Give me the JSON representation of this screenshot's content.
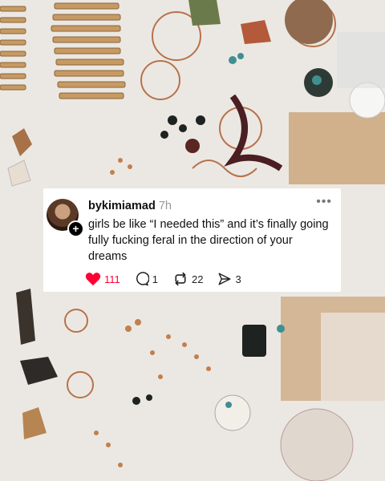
{
  "post": {
    "username": "bykimiamad",
    "time": "7h",
    "text": "girls be like “I needed this” and it’s finally going fully fucking feral in the direction of your dreams",
    "more_icon": "•••"
  },
  "actions": {
    "likes": "111",
    "comments": "1",
    "reposts": "22",
    "shares": "3"
  },
  "colors": {
    "like": "#ff0034",
    "card": "#ffffff",
    "table": "#e9e6e1"
  },
  "icons": [
    "heart-icon",
    "comment-icon",
    "repost-icon",
    "share-icon",
    "plus-icon",
    "more-icon"
  ]
}
